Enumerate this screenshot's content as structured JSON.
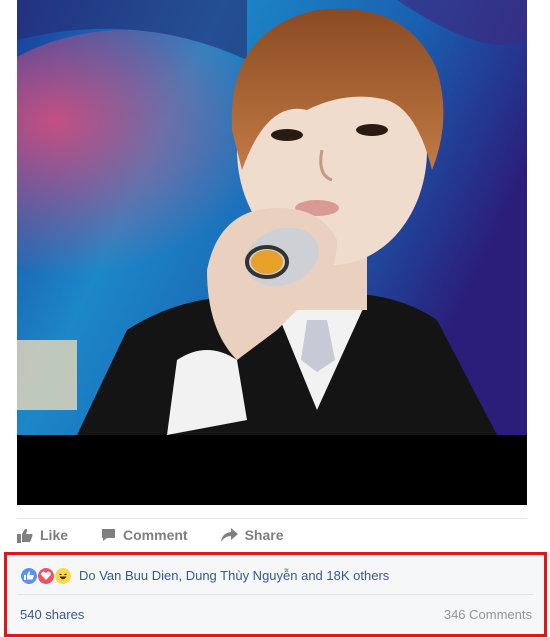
{
  "post": {
    "actions": {
      "like": "Like",
      "comment": "Comment",
      "share": "Share"
    },
    "reactions": {
      "types": [
        "like-icon",
        "love-icon",
        "haha-icon"
      ],
      "summary": "Do Van Buu Dien, Dung Thùy Nguyễn and 18K others"
    },
    "shares": "540 shares",
    "comments": "346 Comments",
    "colors": {
      "link": "#365899",
      "muted": "#90949c",
      "highlight": "#e0161b",
      "like": "#5890ff",
      "love": "#f25268",
      "haha": "#fcd846"
    }
  }
}
